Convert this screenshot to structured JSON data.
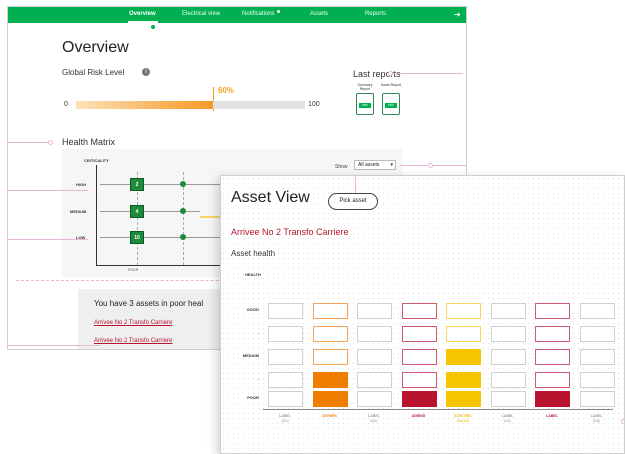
{
  "overview_window": {
    "nav": {
      "items": [
        "Overview",
        "Electrical view",
        "Notifications",
        "Assets",
        "Reports"
      ],
      "active": "Overview"
    },
    "title": "Overview",
    "global_risk": {
      "label": "Global Risk Level",
      "percent_label": "60%",
      "value": 0.6,
      "min_label": "0",
      "max_label": "100"
    },
    "last_reports": {
      "label": "Last reports",
      "items": [
        {
          "name": "Summary Report",
          "badge": "PDF"
        },
        {
          "name": "Asset Report",
          "badge": "PDF"
        }
      ]
    },
    "health_matrix": {
      "label": "Health Matrix",
      "show_label": "Show",
      "show_value": "All assets",
      "y_axis_title": "CRITICALITY",
      "rows": [
        {
          "label": "HIGH",
          "count": "2"
        },
        {
          "label": "MEDIUM",
          "count": "4"
        },
        {
          "label": "LOW",
          "count": "10"
        }
      ],
      "x_ticks": [
        "POOR",
        "-"
      ]
    },
    "poor_health": {
      "text": "You have 3 assets in poor heal",
      "links": [
        "Arrivee No 2 Transfo Carriere",
        "Arrivee No 2 Transfo Carriere"
      ]
    }
  },
  "asset_view_window": {
    "title": "Asset View",
    "pick_button": "Pick asset",
    "asset_name": "Arrivee No 2 Transfo Carriere",
    "section": "Asset health",
    "y_axis_title": "HEALTH",
    "y_labels": [
      "GOOD",
      "-",
      "MEDIUM",
      "-",
      "POOR"
    ],
    "columns": [
      {
        "label": "LABEL",
        "sub": "(NA)",
        "color": "#cccccc",
        "level": 0,
        "outline": "#d0d0d0",
        "label_color": "#999999"
      },
      {
        "label": "OTHERS",
        "sub": "",
        "color": "#f07d00",
        "level": 2,
        "outline": "#f5a45b",
        "label_color": "#f07d00"
      },
      {
        "label": "LABEL",
        "sub": "(NA)",
        "color": "#cccccc",
        "level": 0,
        "outline": "#d0d0d0",
        "label_color": "#999999"
      },
      {
        "label": "AGEING",
        "sub": "",
        "color": "#b8142f",
        "level": 1,
        "outline": "#cf5a70",
        "label_color": "#b8142f"
      },
      {
        "label": "ELECTRIC",
        "sub": "ISSUES",
        "color": "#f7c500",
        "level": 3,
        "outline": "#f7d55a",
        "label_color": "#f0b400"
      },
      {
        "label": "LABEL",
        "sub": "(NA)",
        "color": "#cccccc",
        "level": 0,
        "outline": "#d0d0d0",
        "label_color": "#999999"
      },
      {
        "label": "LABEL",
        "sub": "",
        "color": "#b8142f",
        "level": 1,
        "outline": "#cf5a70",
        "label_color": "#b8142f"
      },
      {
        "label": "LABEL",
        "sub": "(NA)",
        "color": "#cccccc",
        "level": 0,
        "outline": "#d0d0d0",
        "label_color": "#999999"
      }
    ]
  }
}
